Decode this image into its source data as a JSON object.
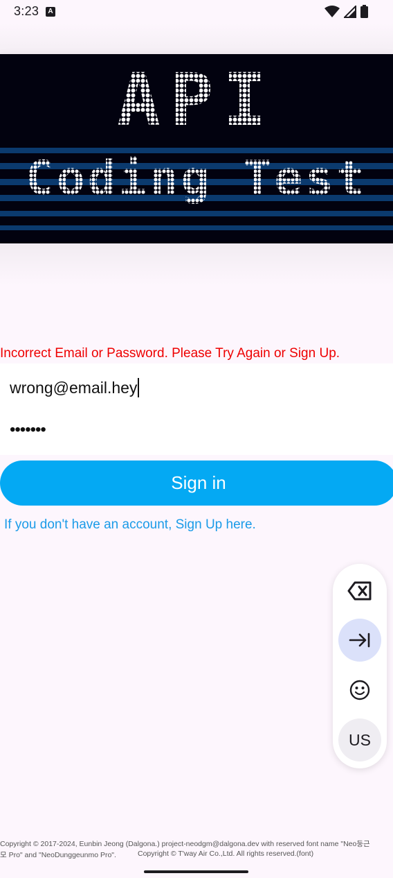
{
  "status_bar": {
    "time": "3:23",
    "app_badge": "A",
    "icons": [
      "wifi-icon",
      "signal-icon",
      "battery-icon"
    ]
  },
  "banner": {
    "title": "API",
    "subtitle": "Coding Test"
  },
  "login": {
    "error_message": "Incorrect Email or Password. Please Try Again or Sign Up.",
    "email_value": "wrong@email.hey",
    "password_value": "•••••••",
    "signin_label": "Sign in",
    "signup_link": "If you don't have an account, Sign Up here."
  },
  "keyboard_toolbar": {
    "buttons": [
      "backspace-icon",
      "tab-icon",
      "emoji-icon"
    ],
    "language_label": "US"
  },
  "footer": {
    "line1": "Copyright © 2017-2024, Eunbin Jeong (Dalgona.) project-neodgm@dalgona.dev with reserved font name \"Neo둥근",
    "line2a": "모 Pro\" and \"NeoDunggeunmo Pro\".",
    "line2b": "Copyright © T'way Air Co.,Ltd. All rights reserved.(font)"
  },
  "colors": {
    "accent": "#04a9f3",
    "error": "#ee0000",
    "link": "#1a9be8",
    "banner_bg": "#02020f",
    "banner_stripe": "#0b3a6e"
  }
}
